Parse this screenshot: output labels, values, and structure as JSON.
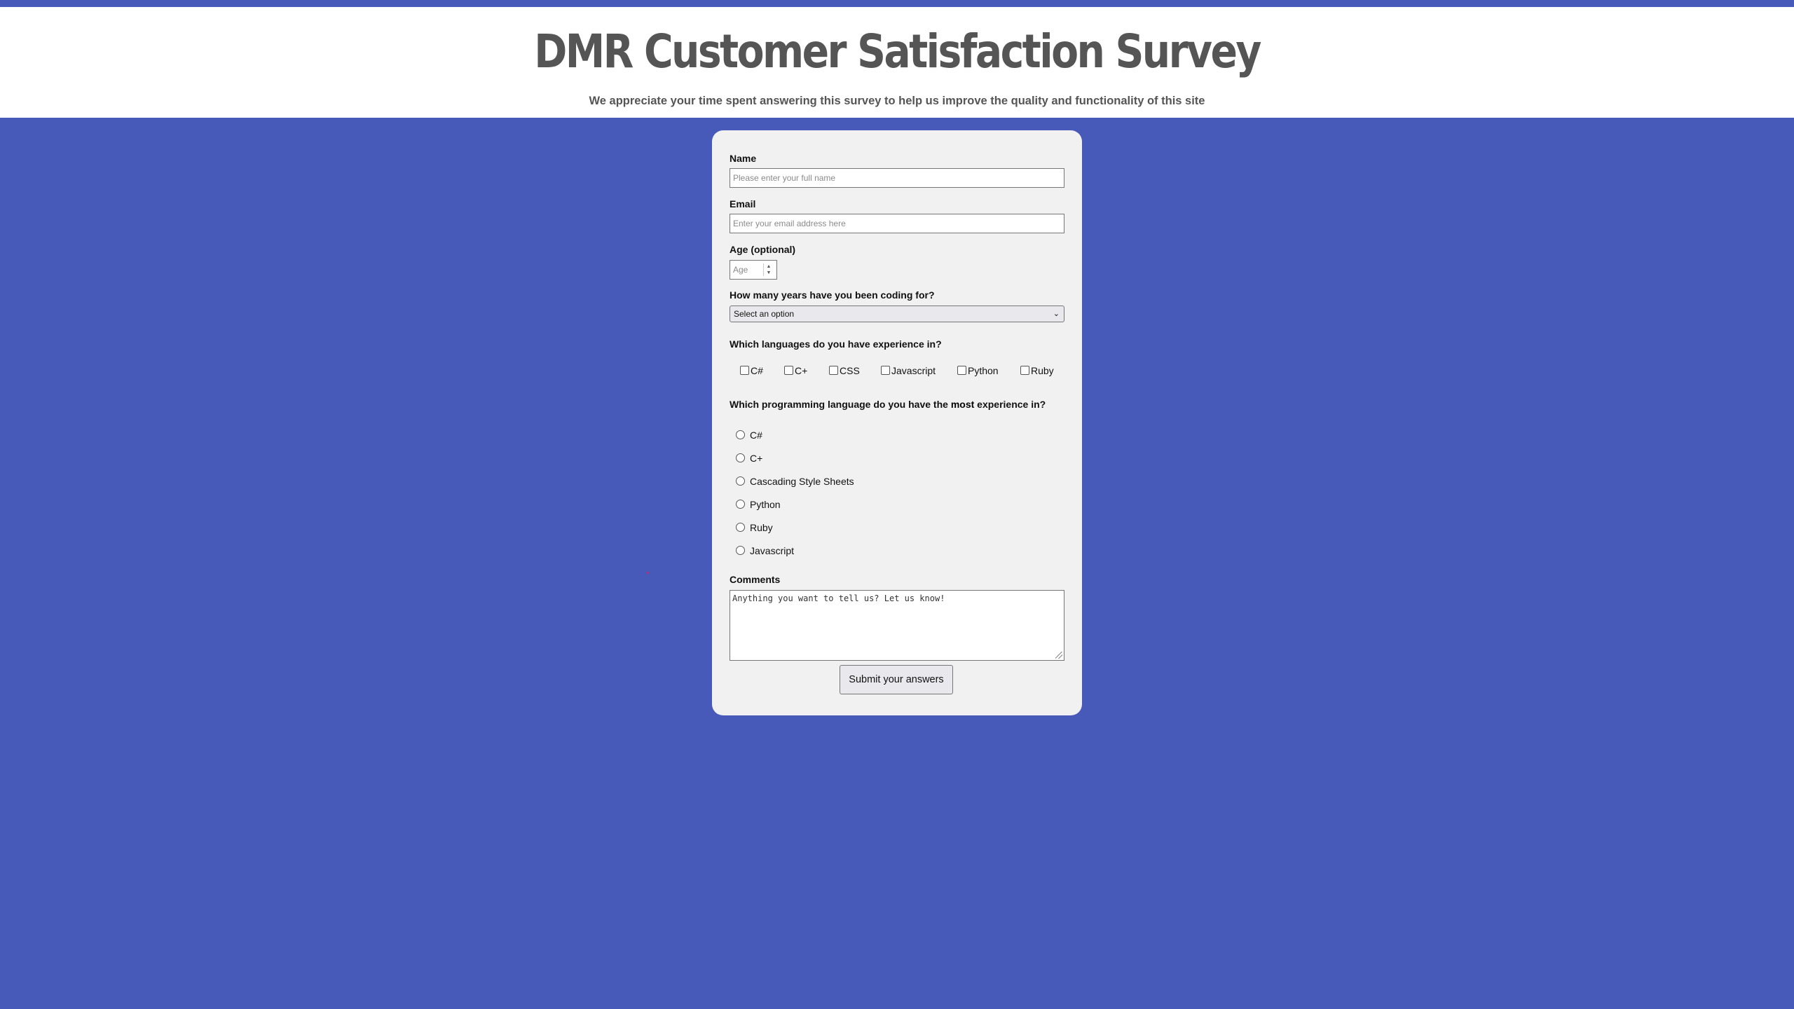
{
  "header": {
    "title": "DMR Customer Satisfaction Survey",
    "subtitle": "We appreciate your time spent answering this survey to help us improve the quality and functionality of this site"
  },
  "form": {
    "name": {
      "label": "Name",
      "placeholder": "Please enter your full name"
    },
    "email": {
      "label": "Email",
      "placeholder": "Enter your email address here"
    },
    "age": {
      "label": "Age (optional)",
      "placeholder": "Age"
    },
    "years": {
      "label": "How many years have you been coding for?",
      "selected": "Select an option"
    },
    "languages": {
      "label": "Which languages do you have experience in?",
      "options": [
        "C#",
        "C+",
        "CSS",
        "Javascript",
        "Python",
        "Ruby"
      ]
    },
    "most": {
      "label_prefix": "Which programming language do you have the ",
      "label_emphasis": "most",
      "label_suffix": " experience in?",
      "options": [
        "C#",
        "C+",
        "Cascading Style Sheets",
        "Python",
        "Ruby",
        "Javascript"
      ]
    },
    "comments": {
      "label": "Comments",
      "placeholder": "Anything you want to tell us? Let us know!"
    },
    "submit_label": "Submit your answers"
  },
  "colors": {
    "background": "#4759b9",
    "header_bg": "#ffffff",
    "card_bg": "#f1f1f1",
    "title_text": "#555555"
  }
}
